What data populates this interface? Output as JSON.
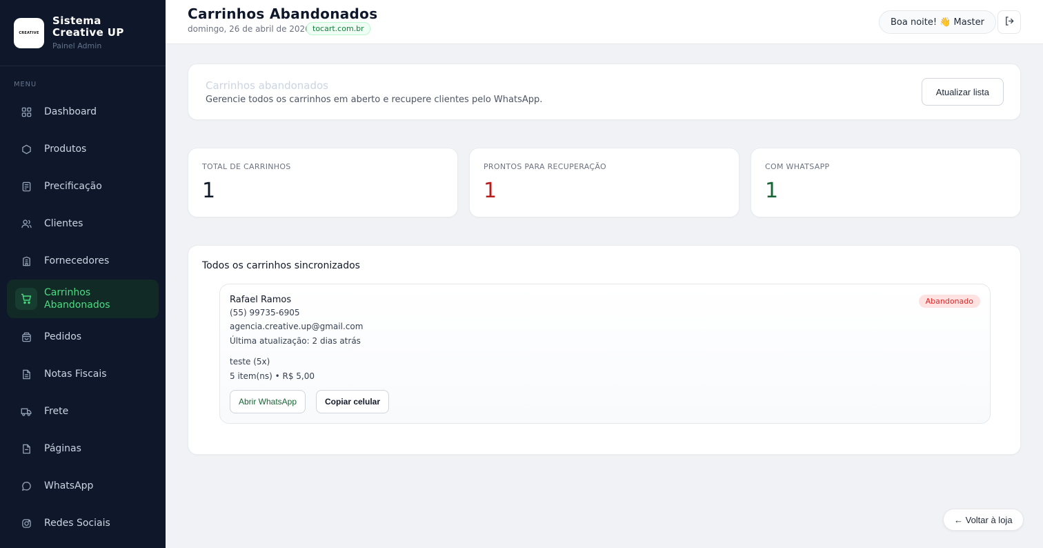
{
  "brand": {
    "logo_text": "CREATIVE",
    "title": "Sistema Creative UP",
    "subtitle": "Painel Admin"
  },
  "sidebar": {
    "menu_label": "MENU",
    "items": [
      {
        "label": "Dashboard",
        "icon": "grid-icon"
      },
      {
        "label": "Produtos",
        "icon": "hexagon-icon"
      },
      {
        "label": "Precificação",
        "icon": "calculator-icon"
      },
      {
        "label": "Clientes",
        "icon": "users-icon"
      },
      {
        "label": "Fornecedores",
        "icon": "building-icon"
      },
      {
        "label": "Carrinhos Abandonados",
        "icon": "cart-icon",
        "active": true
      },
      {
        "label": "Pedidos",
        "icon": "bag-icon"
      },
      {
        "label": "Notas Fiscais",
        "icon": "file-icon"
      },
      {
        "label": "Frete",
        "icon": "truck-icon"
      },
      {
        "label": "Páginas",
        "icon": "page-icon"
      },
      {
        "label": "WhatsApp",
        "icon": "chat-icon"
      },
      {
        "label": "Redes Sociais",
        "icon": "instagram-icon"
      }
    ]
  },
  "header": {
    "title": "Carrinhos Abandonados",
    "date": "domingo, 26 de abril de 2026",
    "domain": "tocart.com.br",
    "greeting": "Boa noite! 👋 Master"
  },
  "intro": {
    "title": "Carrinhos abandonados",
    "description": "Gerencie todos os carrinhos em aberto e recupere clientes pelo WhatsApp.",
    "refresh_label": "Atualizar lista"
  },
  "stats": [
    {
      "label": "TOTAL DE CARRINHOS",
      "value": "1",
      "color": "#0f172a"
    },
    {
      "label": "PRONTOS PARA RECUPERAÇÃO",
      "value": "1",
      "color": "#b91c1c"
    },
    {
      "label": "COM WHATSAPP",
      "value": "1",
      "color": "#166534"
    }
  ],
  "list": {
    "title": "Todos os carrinhos sincronizados",
    "carts": [
      {
        "name": "Rafael Ramos",
        "phone": "(55) 99735-6905",
        "email": "agencia.creative.up@gmail.com",
        "updated": "Última atualização: 2 dias atrás",
        "items_text": "teste (5x)",
        "summary": "5 item(ns) • R$ 5,00",
        "status": "Abandonado",
        "whatsapp_label": "Abrir WhatsApp",
        "copy_label": "Copiar celular"
      }
    ]
  },
  "back_label": "← Voltar à loja",
  "colors": {
    "sidebar_bg": "#0f172a",
    "accent": "#4ade80",
    "danger": "#dc2626",
    "success": "#166534"
  }
}
